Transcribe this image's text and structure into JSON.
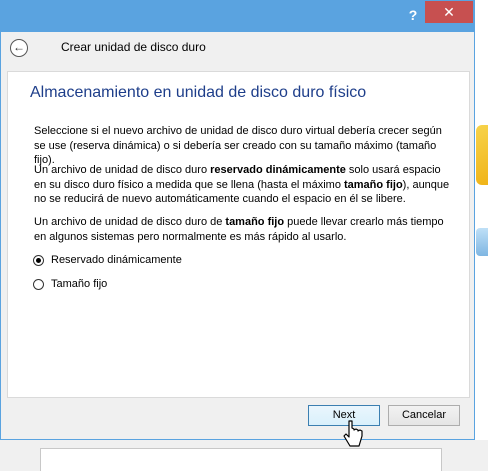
{
  "window": {
    "help_label": "?",
    "close_label": "✕"
  },
  "wizard": {
    "back_label": "←",
    "title": "Crear unidad de disco duro"
  },
  "page": {
    "heading": "Almacenamiento en unidad de disco duro físico",
    "paragraph1": "Seleccione si el nuevo archivo de unidad de disco duro virtual debería crecer según se use (reserva dinámica) o si debería ser creado con su tamaño máximo (tamaño fijo).",
    "paragraph2": {
      "part1": "Un archivo de unidad de disco duro ",
      "bold1": "reservado dinámicamente",
      "part2": " solo usará espacio en su disco duro físico a medida que se llena (hasta el máximo ",
      "bold2": "tamaño fijo",
      "part3": "), aunque no se reducirá de nuevo automáticamente cuando el espacio en él se libere."
    },
    "paragraph3": {
      "part1": "Un archivo de unidad de disco duro de ",
      "bold1": "tamaño fijo",
      "part2": " puede llevar crearlo más tiempo en algunos sistemas pero normalmente es más rápido al usarlo."
    },
    "options": [
      {
        "label": "Reservado dinámicamente",
        "selected": true
      },
      {
        "label": "Tamaño fijo",
        "selected": false
      }
    ]
  },
  "buttons": {
    "next": "Next",
    "cancel": "Cancelar"
  },
  "colors": {
    "titlebar": "#5aa3e0",
    "close": "#c75050",
    "heading": "#1e3e8a"
  }
}
